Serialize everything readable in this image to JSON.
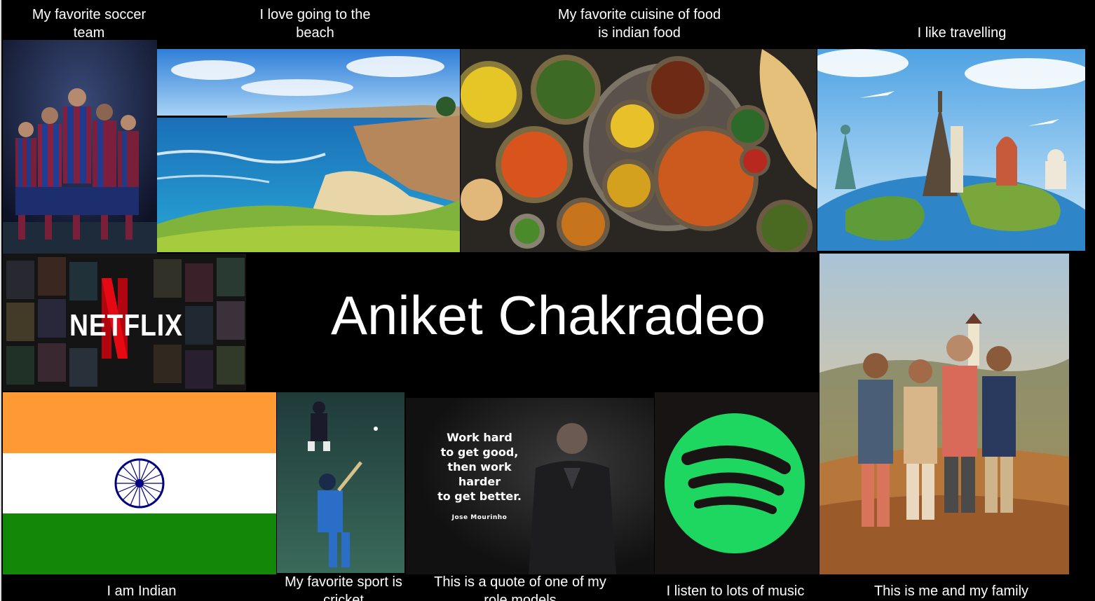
{
  "slide": {
    "title": "Aniket Chakradeo",
    "captions": {
      "soccer": "My favorite soccer team",
      "beach": "I love going to the beach",
      "food": "My favorite cuisine of food is indian food",
      "travel": "I like travelling",
      "indian": "I am Indian",
      "cricket": "My favorite sport is cricket",
      "quote": "This is a quote of one of my role models",
      "music": "I listen to lots of music",
      "family": "This is me and my family"
    },
    "netflix_logo_text": "NETFLIX",
    "quote_text": {
      "line1": "Work hard",
      "line2": "to get good,",
      "line3": "then work",
      "line4": "harder",
      "line5": "to get better.",
      "author": "Jose Mourinho"
    },
    "colors": {
      "background": "#000000",
      "netflix_red": "#e50914",
      "spotify_green": "#1ed760",
      "saffron": "#ff9933",
      "india_green": "#138808",
      "chakra_blue": "#000080"
    }
  }
}
